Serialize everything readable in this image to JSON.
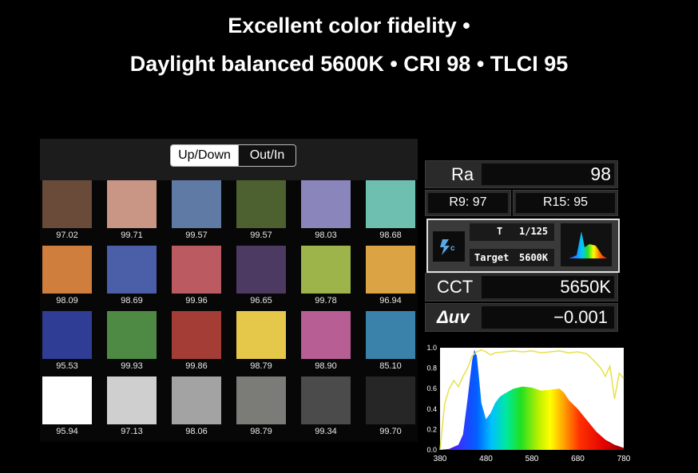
{
  "headline": {
    "line1": "Excellent color fidelity •",
    "line2": "Daylight balanced 5600K • CRI 98 • TLCI 95"
  },
  "toggle": {
    "active": "Up/Down",
    "inactive": "Out/In"
  },
  "swatches": [
    {
      "color": "#6a4a38",
      "value": "97.02"
    },
    {
      "color": "#c99585",
      "value": "99.71"
    },
    {
      "color": "#5f7aa4",
      "value": "99.57"
    },
    {
      "color": "#4c6030",
      "value": "99.57"
    },
    {
      "color": "#8a86bc",
      "value": "98.03"
    },
    {
      "color": "#6fbfb0",
      "value": "98.68"
    },
    {
      "color": "#d07e3e",
      "value": "98.09"
    },
    {
      "color": "#4b5ea8",
      "value": "98.69"
    },
    {
      "color": "#bc5a62",
      "value": "99.96"
    },
    {
      "color": "#4d3a63",
      "value": "96.65"
    },
    {
      "color": "#9db44a",
      "value": "99.78"
    },
    {
      "color": "#dca345",
      "value": "96.94"
    },
    {
      "color": "#303d94",
      "value": "95.53"
    },
    {
      "color": "#4e8a44",
      "value": "99.93"
    },
    {
      "color": "#a33d36",
      "value": "99.86"
    },
    {
      "color": "#e5c84a",
      "value": "98.79"
    },
    {
      "color": "#b75f94",
      "value": "98.90"
    },
    {
      "color": "#3b82aa",
      "value": "85.10"
    },
    {
      "color": "#ffffff",
      "value": "95.94"
    },
    {
      "color": "#cfcfcf",
      "value": "97.13"
    },
    {
      "color": "#a3a3a3",
      "value": "98.06"
    },
    {
      "color": "#7b7c78",
      "value": "98.79"
    },
    {
      "color": "#4b4b4b",
      "value": "99.34"
    },
    {
      "color": "#262626",
      "value": "99.70"
    }
  ],
  "meter": {
    "ra_label": "Ra",
    "ra_value": "98",
    "r9": "R9: 97",
    "r15": "R15: 95",
    "t_label": "T",
    "t_value": "1/125",
    "target_label": "Target",
    "target_value": "5600K",
    "flash_icon": "flash-c-icon",
    "cct_label": "CCT",
    "cct_value": "5650K",
    "duv_label": "Δuv",
    "duv_value": "−0.001"
  },
  "chart_data": {
    "type": "line",
    "x_ticks": [
      "380",
      "480",
      "580",
      "680",
      "780"
    ],
    "y_ticks": [
      "0.0",
      "0.2",
      "0.4",
      "0.6",
      "0.8",
      "1.0"
    ],
    "xlim": [
      380,
      780
    ],
    "ylim": [
      0,
      1
    ],
    "series": [
      {
        "style": "spectrum-fill",
        "x": [
          380,
          400,
          420,
          430,
          440,
          450,
          455,
          460,
          465,
          470,
          480,
          490,
          500,
          510,
          520,
          540,
          560,
          580,
          600,
          620,
          640,
          650,
          660,
          680,
          700,
          720,
          740,
          760,
          780
        ],
        "values": [
          0.0,
          0.01,
          0.05,
          0.15,
          0.5,
          0.88,
          0.98,
          0.92,
          0.7,
          0.46,
          0.3,
          0.36,
          0.46,
          0.52,
          0.55,
          0.6,
          0.62,
          0.61,
          0.58,
          0.59,
          0.6,
          0.56,
          0.49,
          0.4,
          0.29,
          0.18,
          0.1,
          0.05,
          0.02
        ]
      },
      {
        "style": "reference-line",
        "color": "#e6e14a",
        "x": [
          380,
          390,
          400,
          410,
          420,
          430,
          440,
          450,
          460,
          470,
          480,
          490,
          500,
          520,
          540,
          560,
          580,
          600,
          620,
          640,
          660,
          680,
          700,
          720,
          730,
          740,
          750,
          760,
          770,
          780
        ],
        "values": [
          0.0,
          0.45,
          0.6,
          0.68,
          0.62,
          0.72,
          0.8,
          0.92,
          0.96,
          0.98,
          0.96,
          0.93,
          0.95,
          0.96,
          0.97,
          0.96,
          0.97,
          0.95,
          0.96,
          0.97,
          0.95,
          0.96,
          0.94,
          0.85,
          0.8,
          0.72,
          0.82,
          0.5,
          0.75,
          0.7
        ]
      }
    ]
  }
}
